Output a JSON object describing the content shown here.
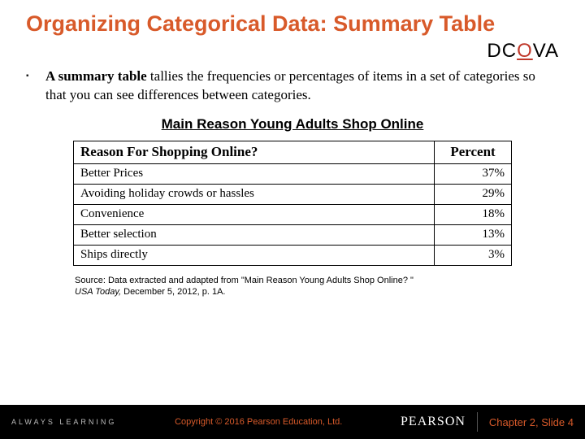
{
  "title": "Organizing Categorical Data: Summary Table",
  "dcova": {
    "d": "D",
    "c": "C",
    "o": "O",
    "v": "V",
    "a": "A"
  },
  "bullet": {
    "lead": "A summary table",
    "rest": " tallies the frequencies or percentages of items in a set of categories so that you can see differences between categories."
  },
  "table_heading": "Main Reason Young Adults Shop Online",
  "table": {
    "col_reason": "Reason For Shopping Online?",
    "col_percent": "Percent"
  },
  "chart_data": {
    "type": "table",
    "title": "Main Reason Young Adults Shop Online",
    "columns": [
      "Reason For Shopping Online?",
      "Percent"
    ],
    "rows": [
      {
        "reason": "Better Prices",
        "percent": "37%"
      },
      {
        "reason": "Avoiding holiday crowds or hassles",
        "percent": "29%"
      },
      {
        "reason": "Convenience",
        "percent": "18%"
      },
      {
        "reason": "Better selection",
        "percent": "13%"
      },
      {
        "reason": "Ships directly",
        "percent": "3%"
      }
    ]
  },
  "source": {
    "line1": "Source: Data extracted and adapted from \"Main Reason Young Adults Shop Online? \"",
    "pub": "USA Today, ",
    "date": "December 5, 2012, p. 1A."
  },
  "footer": {
    "left": "ALWAYS LEARNING",
    "copyright": "Copyright © 2016 Pearson Education, Ltd.",
    "brand": "PEARSON",
    "slide": "Chapter 2, Slide 4"
  }
}
